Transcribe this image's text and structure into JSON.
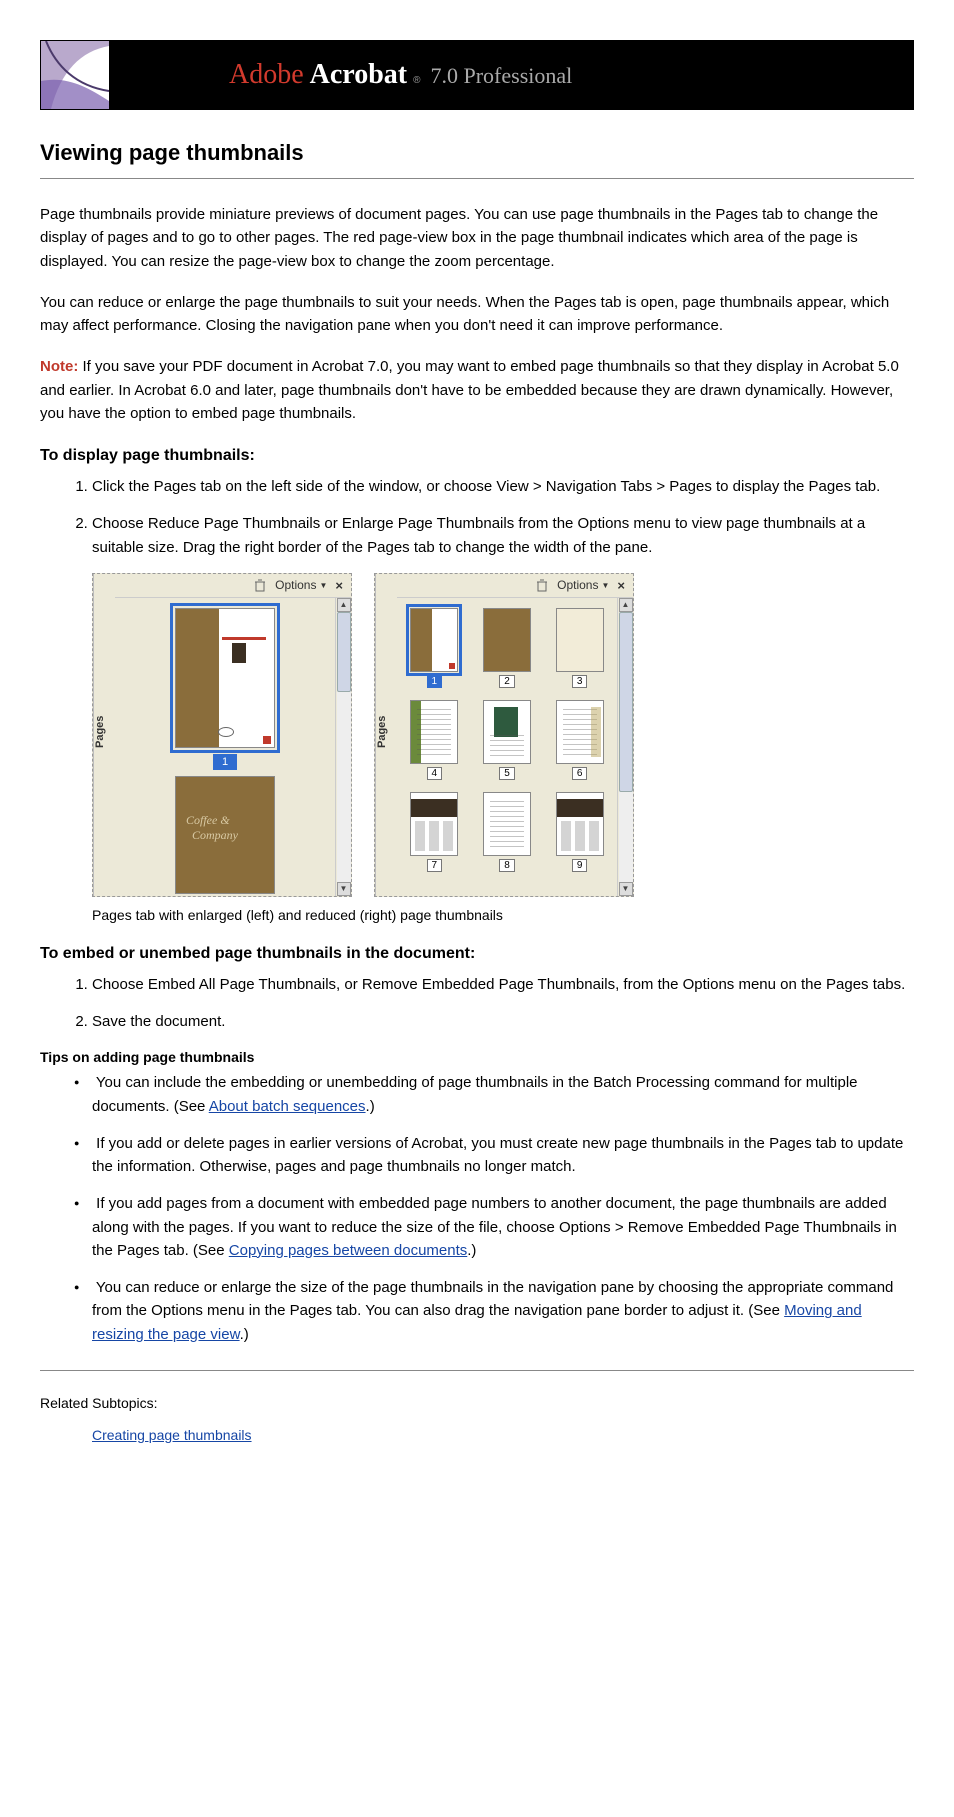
{
  "banner": {
    "adobe": "Adobe",
    "product": "Acrobat",
    "reg": "®",
    "version": "7.0 Professional"
  },
  "title": "Viewing page thumbnails",
  "intro1": "Page thumbnails provide miniature previews of document pages. You can use page thumbnails in the Pages tab to change the display of pages and to go to other pages. The red page-view box in the page thumbnail indicates which area of the page is displayed. You can resize the page-view box to change the zoom percentage.",
  "intro2": "You can reduce or enlarge the page thumbnails to suit your needs. When the Pages tab is open, page thumbnails appear, which may affect performance. Closing the navigation pane when you don't need it can improve performance.",
  "note_label": "Note:",
  "note": "If you save your PDF document in Acrobat 7.0, you may want to embed page thumbnails so that they display in Acrobat 5.0 and earlier. In Acrobat 6.0 and later, page thumbnails don't have to be embedded because they are drawn dynamically. However, you have the option to embed page thumbnails.",
  "sections": {
    "display": {
      "heading": "To display page thumbnails:",
      "steps": [
        "Click the Pages tab on the left side of the window, or choose View > Navigation Tabs > Pages to display the Pages tab.",
        "Choose Reduce Page Thumbnails or Enlarge Page Thumbnails from the Options menu to view page thumbnails at a suitable size. Drag the right border of the Pages tab to change the width of the pane."
      ]
    }
  },
  "caption": "Pages tab with enlarged (left) and reduced (right) page thumbnails",
  "pages_panel": {
    "tab_label": "Pages",
    "options": "Options",
    "page_numbers": [
      "1",
      "2",
      "3",
      "4",
      "5",
      "6",
      "7",
      "8",
      "9"
    ]
  },
  "embed": {
    "heading": "To embed or unembed page thumbnails in the document:",
    "steps": [
      "Choose Embed All Page Thumbnails, or Remove Embedded Page Thumbnails, from the Options menu on the Pages tabs.",
      "Save the document."
    ]
  },
  "tips_heading": "Tips on adding page thumbnails",
  "tips": [
    {
      "pre": "You can include the embedding or unembedding of page thumbnails in the Batch Processing command for multiple documents. (See ",
      "link": "About batch sequences",
      "post": ".)"
    },
    {
      "pre": "If you add or delete pages in earlier versions of Acrobat, you must create new page thumbnails in the Pages tab to update the information. Otherwise, pages and page thumbnails no longer match.",
      "link": "",
      "post": ""
    },
    {
      "pre": "If you add pages from a document with embedded page numbers to another document, the page thumbnails are added along with the pages. If you want to reduce the size of the file, choose Options > Remove Embedded Page Thumbnails in the Pages tab. (See ",
      "link": "Copying pages between documents",
      "post": ".)"
    },
    {
      "pre": "You can reduce or enlarge the size of the page thumbnails in the navigation pane by choosing the appropriate command from the Options menu in the Pages tab. You can also drag the navigation pane border to adjust it. (See ",
      "link": "Moving and resizing the page view",
      "post": ".)"
    }
  ],
  "related_label": "Related Subtopics:",
  "related_link": "Creating page thumbnails"
}
